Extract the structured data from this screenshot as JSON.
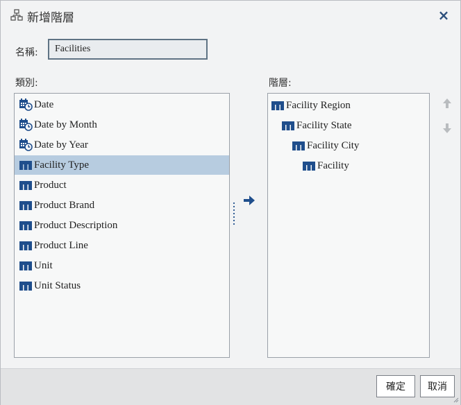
{
  "dialog": {
    "title": "新增階層",
    "close_symbol": "×",
    "title_icon": "hierarchy-icon",
    "close_icon": "close-icon"
  },
  "name_field": {
    "label": "名稱:",
    "value": "Facilities"
  },
  "categories": {
    "label": "類別:",
    "items": [
      {
        "label": "Date",
        "icon": "date-calendar-icon",
        "selected": false
      },
      {
        "label": "Date by Month",
        "icon": "date-calendar-icon",
        "selected": false
      },
      {
        "label": "Date by Year",
        "icon": "date-calendar-icon",
        "selected": false
      },
      {
        "label": "Facility Type",
        "icon": "category-icon",
        "selected": true
      },
      {
        "label": "Product",
        "icon": "category-icon",
        "selected": false
      },
      {
        "label": "Product Brand",
        "icon": "category-icon",
        "selected": false
      },
      {
        "label": "Product Description",
        "icon": "category-icon",
        "selected": false
      },
      {
        "label": "Product Line",
        "icon": "category-icon",
        "selected": false
      },
      {
        "label": "Unit",
        "icon": "category-icon",
        "selected": false
      },
      {
        "label": "Unit Status",
        "icon": "category-icon",
        "selected": false
      }
    ]
  },
  "hierarchy": {
    "label": "階層:",
    "items": [
      {
        "label": "Facility Region",
        "level": 0,
        "icon": "category-icon"
      },
      {
        "label": "Facility State",
        "level": 1,
        "icon": "category-icon"
      },
      {
        "label": "Facility City",
        "level": 2,
        "icon": "category-icon"
      },
      {
        "label": "Facility",
        "level": 3,
        "icon": "category-icon"
      }
    ]
  },
  "buttons": {
    "ok": "確定",
    "cancel": "取消"
  },
  "colors": {
    "icon_blue": "#1f4e8c",
    "selection": "#b7cce0",
    "arrow_disabled": "#b9bcbf"
  }
}
